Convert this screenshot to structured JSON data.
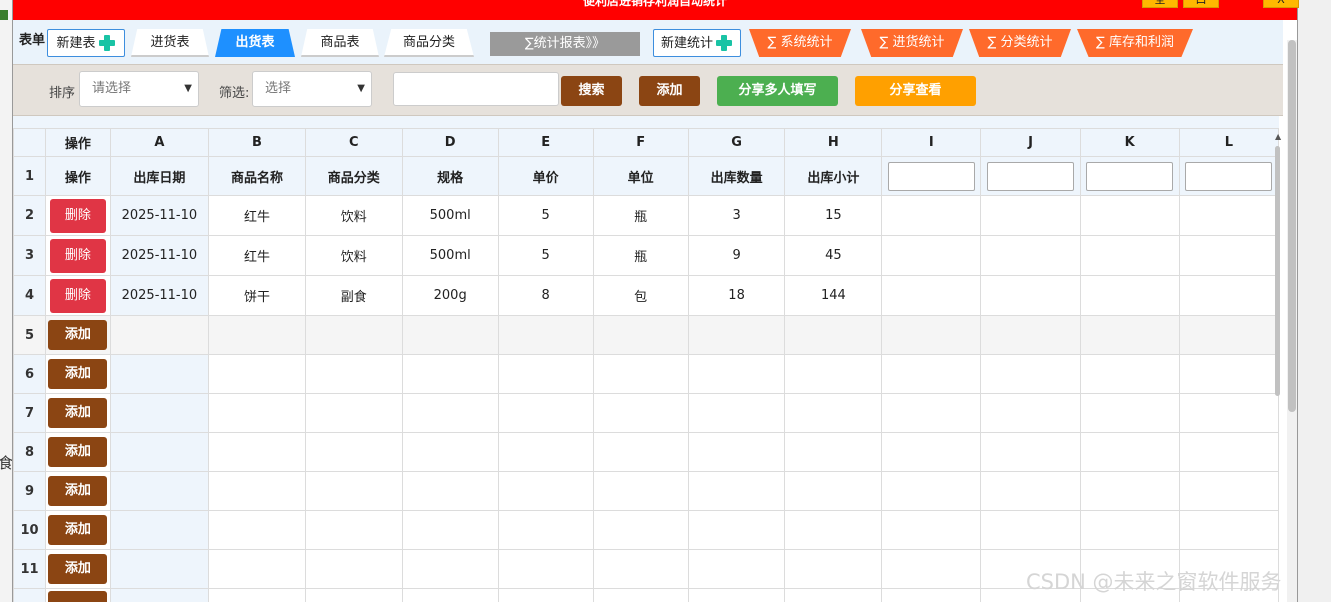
{
  "window": {
    "title": "便利店进销存利润自动统计",
    "controls": [
      "全",
      "口",
      "X"
    ]
  },
  "tabbar": {
    "label": "表单",
    "tabs": [
      {
        "label": "新建表"
      },
      {
        "label": "进货表"
      },
      {
        "label": "出货表",
        "active": true
      },
      {
        "label": "商品表"
      },
      {
        "label": "商品分类"
      },
      {
        "label": "∑统计报表》》"
      },
      {
        "label": "新建统计"
      },
      {
        "label": "∑ 系统统计"
      },
      {
        "label": "∑ 进货统计"
      },
      {
        "label": "∑ 分类统计"
      },
      {
        "label": "∑ 库存和利润"
      }
    ]
  },
  "toolbar": {
    "sort_label": "排序",
    "sort_placeholder": "请选择",
    "filter_label": "筛选:",
    "filter_placeholder": "选择",
    "search_value": "",
    "search_button": "搜索",
    "add_button": "添加",
    "share_fill_button": "分享多人填写",
    "share_view_button": "分享查看"
  },
  "grid": {
    "column_letters": [
      "操作",
      "A",
      "B",
      "C",
      "D",
      "E",
      "F",
      "G",
      "H",
      "I",
      "J",
      "K",
      "L"
    ],
    "header_row_number": "1",
    "headers": [
      "操作",
      "出库日期",
      "商品名称",
      "商品分类",
      "规格",
      "单价",
      "单位",
      "出库数量",
      "出库小计"
    ],
    "delete_label": "删除",
    "add_label": "添加",
    "rows": [
      {
        "num": "2",
        "cells": [
          "2025-11-10",
          "红牛",
          "饮料",
          "500ml",
          "5",
          "瓶",
          "3",
          "15"
        ]
      },
      {
        "num": "3",
        "cells": [
          "2025-11-10",
          "红牛",
          "饮料",
          "500ml",
          "5",
          "瓶",
          "9",
          "45"
        ]
      },
      {
        "num": "4",
        "cells": [
          "2025-11-10",
          "饼干",
          "副食",
          "200g",
          "8",
          "包",
          "18",
          "144"
        ]
      }
    ],
    "empty_rows": [
      "5",
      "6",
      "7",
      "8",
      "9",
      "10",
      "11"
    ]
  },
  "background": {
    "glyph": "食"
  },
  "watermark": "CSDN @未来之窗软件服务",
  "colors": {
    "titlebar": "#ff0000",
    "active_tab": "#1e90ff",
    "orange_tab": "#ff6a2b",
    "brown_button": "#8b4513",
    "green_button": "#4caf50",
    "amber_button": "#ffa000",
    "delete_button": "#e03545"
  }
}
